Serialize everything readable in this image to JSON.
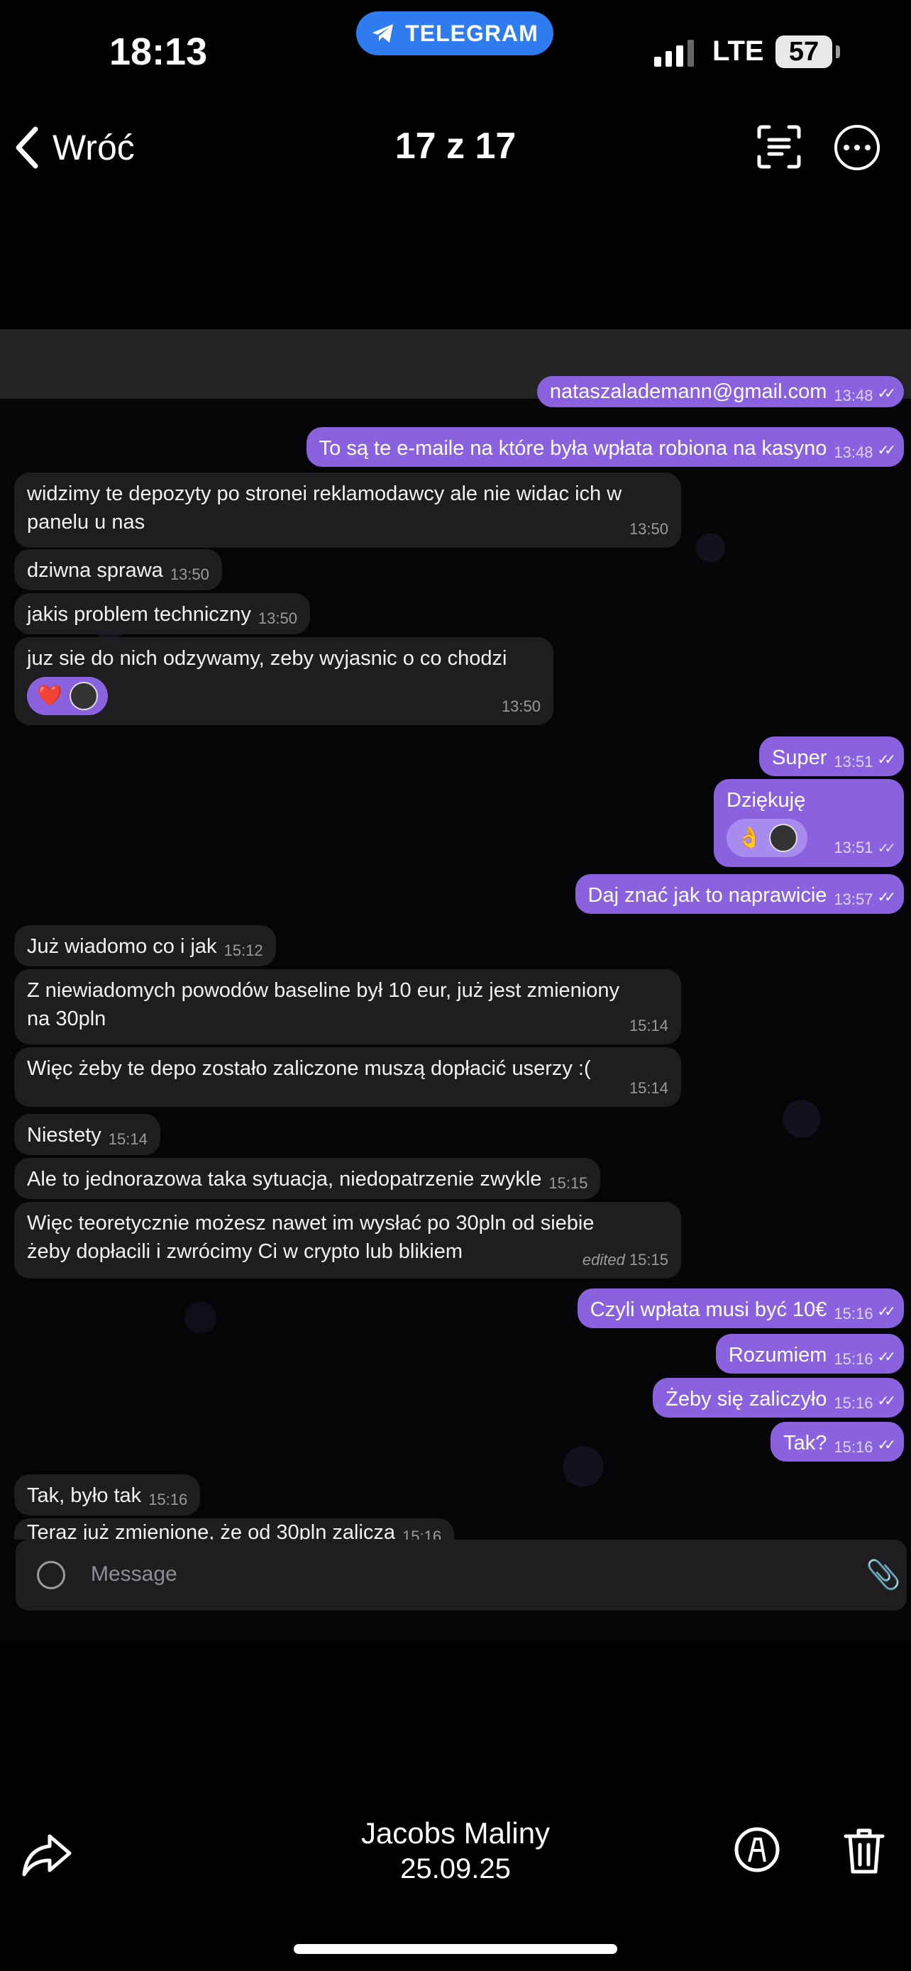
{
  "status_bar": {
    "time": "18:13",
    "app_pill": "TELEGRAM",
    "network": "LTE",
    "battery": "57"
  },
  "viewer": {
    "back_label": "Wróć",
    "title": "17 z 17"
  },
  "chat": {
    "partial_top": {
      "text": "nataszalademann@gmail.com",
      "time": "13:48"
    },
    "messages": [
      {
        "text": "To są te e-maile na które była wpłata robiona na kasyno",
        "time": "13:48"
      },
      {
        "line1": "widzimy te depozyty po stronei reklamodawcy ale nie widac ich w",
        "line2": "panelu u nas",
        "time": "13:50"
      },
      {
        "text": "dziwna sprawa",
        "time": "13:50"
      },
      {
        "text": "jakis problem techniczny",
        "time": "13:50"
      },
      {
        "text": "juz sie do nich odzywamy, zeby wyjasnic o co chodzi",
        "time": "13:50",
        "reaction": "❤️"
      },
      {
        "text": "Super",
        "time": "13:51"
      },
      {
        "text": "Dziękuję",
        "time": "13:51",
        "reaction": "👌"
      },
      {
        "text": "Daj znać jak to naprawicie",
        "time": "13:57"
      },
      {
        "text": "Już wiadomo co i jak",
        "time": "15:12"
      },
      {
        "line1": "Z niewiadomych powodów baseline był 10 eur, już jest zmieniony",
        "line2": "na 30pln",
        "time": "15:14"
      },
      {
        "text": "Więc żeby te depo zostało zaliczone muszą dopłacić userzy :(",
        "time": "15:14"
      },
      {
        "text": "Niestety",
        "time": "15:14"
      },
      {
        "text": "Ale to jednorazowa taka sytuacja, niedopatrzenie zwykle",
        "time": "15:15"
      },
      {
        "line1": "Więc teoretycznie możesz nawet im wysłać po 30pln od siebie",
        "line2": "żeby dopłacili  i zwrócimy Ci w crypto lub blikiem",
        "edited": "edited",
        "time": "15:15"
      },
      {
        "text": "Czyli wpłata musi być 10€",
        "time": "15:16"
      },
      {
        "text": "Rozumiem",
        "time": "15:16"
      },
      {
        "text": "Żeby się zaliczyło",
        "time": "15:16"
      },
      {
        "text": "Tak?",
        "time": "15:16"
      },
      {
        "text": "Tak, było tak",
        "time": "15:16"
      },
      {
        "text": "Teraz już zmienione, że od 30pln zalicza",
        "time": "15:16"
      }
    ],
    "input_placeholder": "Message"
  },
  "bottom": {
    "name": "Jacobs Maliny",
    "date": "25.09.25"
  },
  "colors": {
    "outgoing": "#8a62e0",
    "incoming": "#1e1e21",
    "pill": "#2f7bf0"
  }
}
